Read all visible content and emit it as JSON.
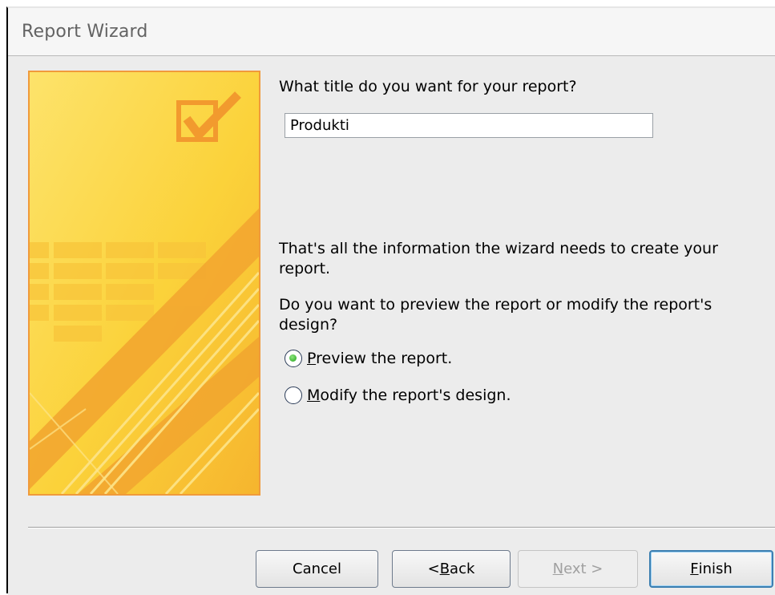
{
  "window": {
    "title": "Report Wizard"
  },
  "title_section": {
    "question": "What title do you want for your report?",
    "input_value": "Produkti"
  },
  "info": {
    "line1": "That's all the information the wizard needs to create your report.",
    "line2": "Do you want to preview the report or modify the report's design?"
  },
  "options": [
    {
      "accel": "P",
      "rest": "review the report.",
      "selected": true
    },
    {
      "accel": "M",
      "rest": "odify the report's design.",
      "selected": false
    }
  ],
  "buttons": {
    "cancel": {
      "pre": "Cancel",
      "accel": "",
      "post": ""
    },
    "back": {
      "pre": "< ",
      "accel": "B",
      "post": "ack"
    },
    "next": {
      "pre": "",
      "accel": "N",
      "post": "ext >",
      "enabled": false
    },
    "finish": {
      "pre": "",
      "accel": "F",
      "post": "inish"
    }
  },
  "colors": {
    "art_border": "#f09a3b",
    "art_yellow": "#fbd23a",
    "art_orange": "#f2a52f",
    "radio_selected": "#22a31a",
    "finish_focus": "#3c7fb1"
  },
  "icons": {
    "wizard_art": "checkbox-checkmark-art",
    "radio_on": "radio-selected-icon",
    "radio_off": "radio-empty-icon"
  }
}
